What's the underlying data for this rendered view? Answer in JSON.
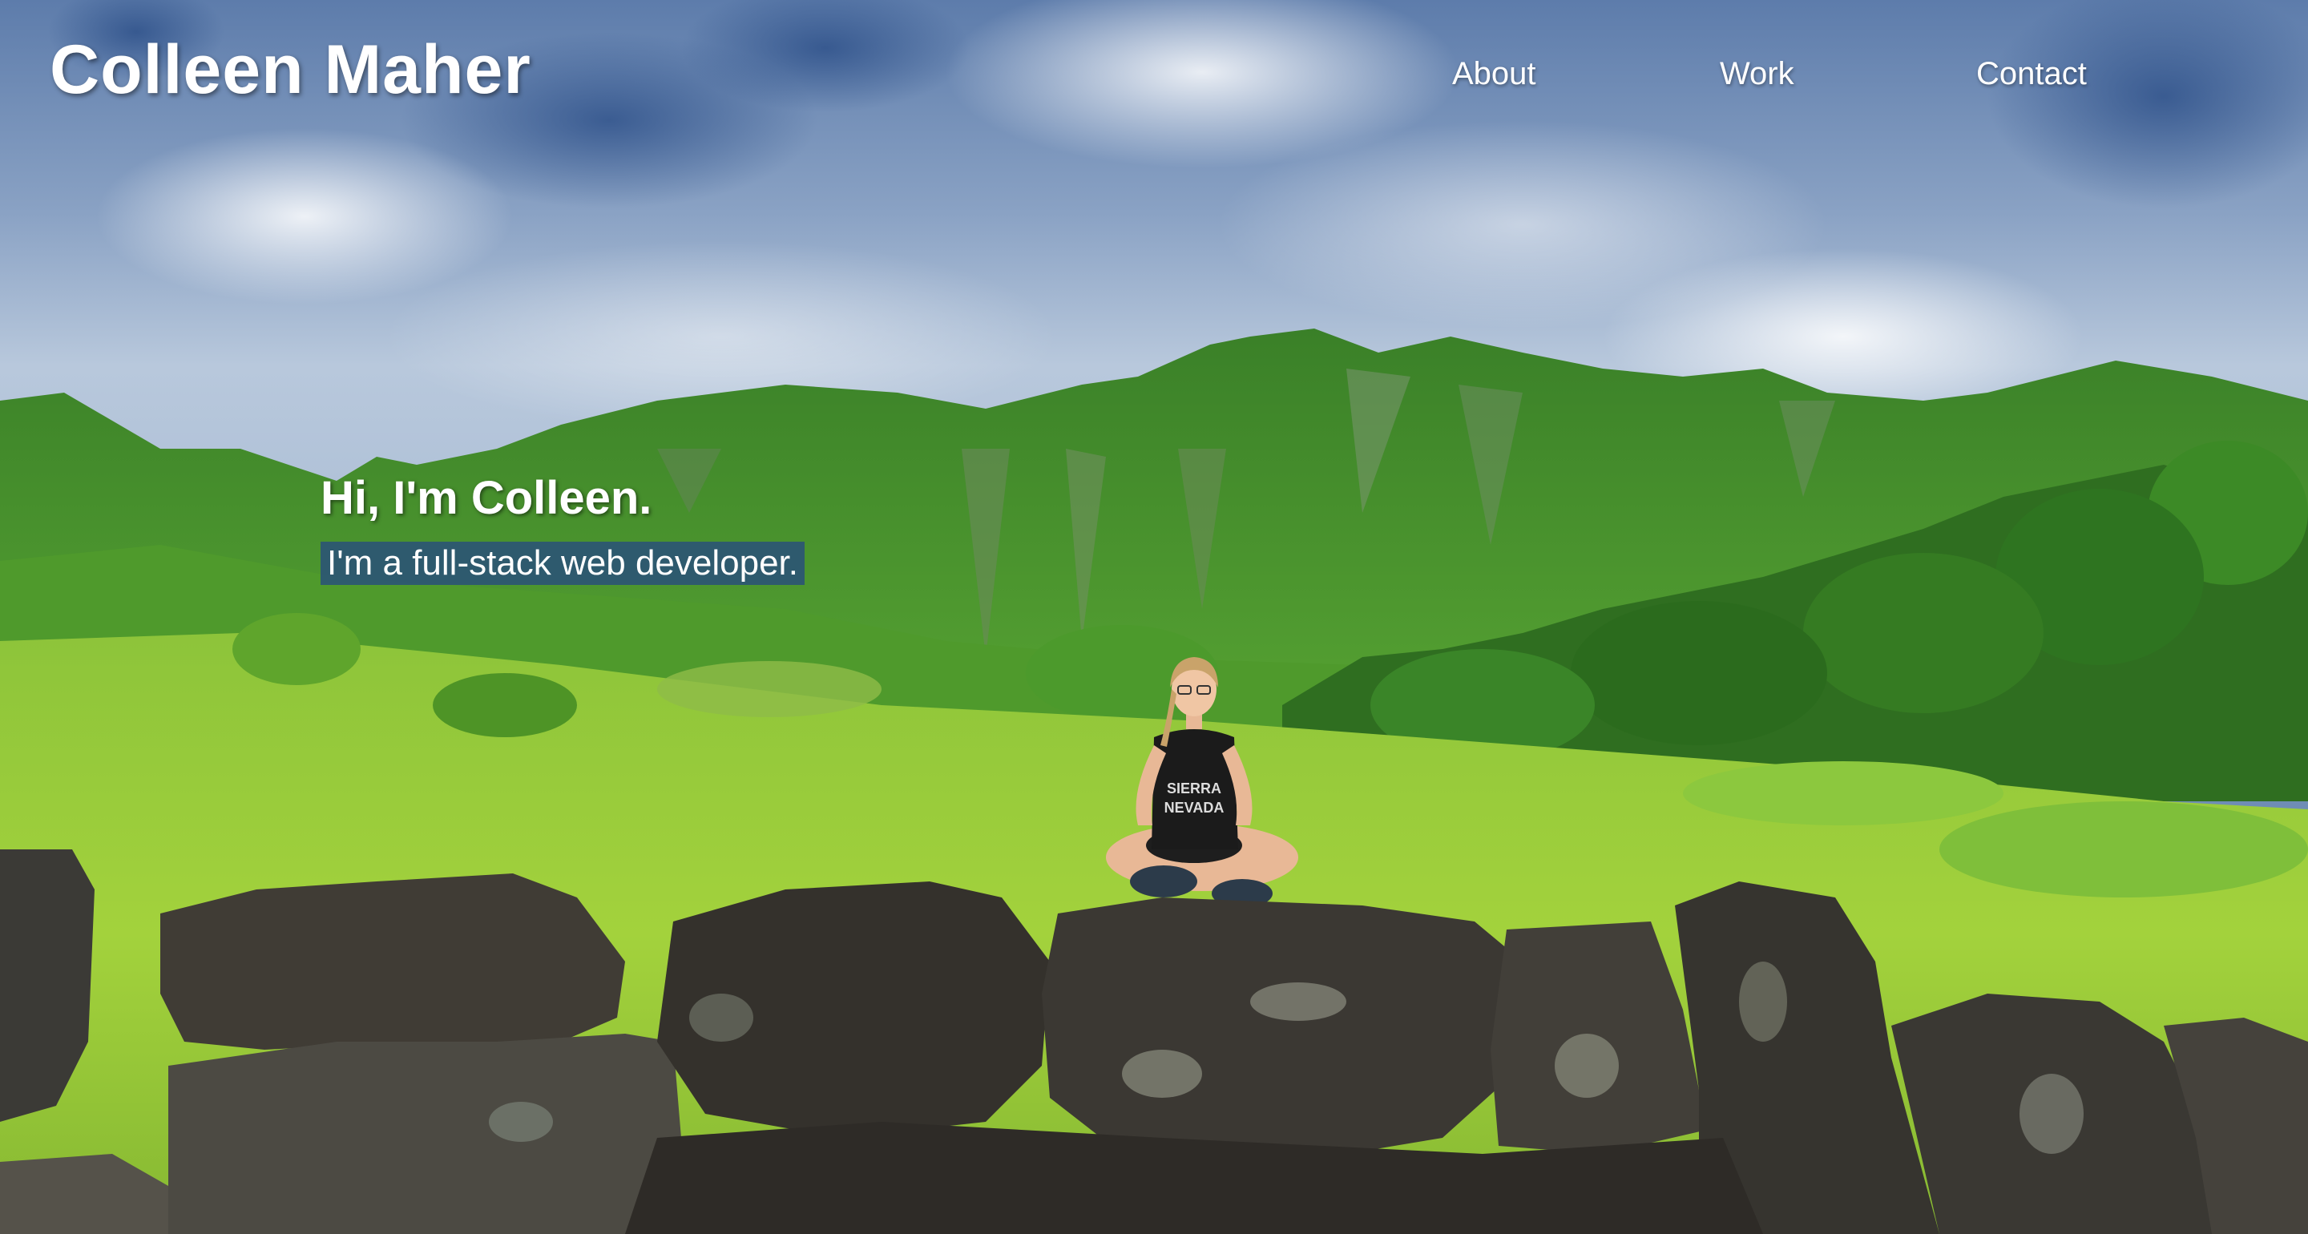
{
  "header": {
    "site_title": "Colleen Maher"
  },
  "nav": {
    "items": [
      {
        "label": "About"
      },
      {
        "label": "Work"
      },
      {
        "label": "Contact"
      }
    ]
  },
  "hero": {
    "greeting": "Hi, I'm Colleen.",
    "tagline": "I'm a full-stack web developer.",
    "shirt_text_1": "SIERRA",
    "shirt_text_2": "NEVADA"
  },
  "colors": {
    "sky_top": "#4a6a9a",
    "sky_light": "#c9d6e6",
    "mountain_green": "#3f8a2a",
    "grass": "#9ccd3a",
    "rock": "#3a3630",
    "tagline_bg": "#2a5278",
    "text": "#ffffff"
  }
}
